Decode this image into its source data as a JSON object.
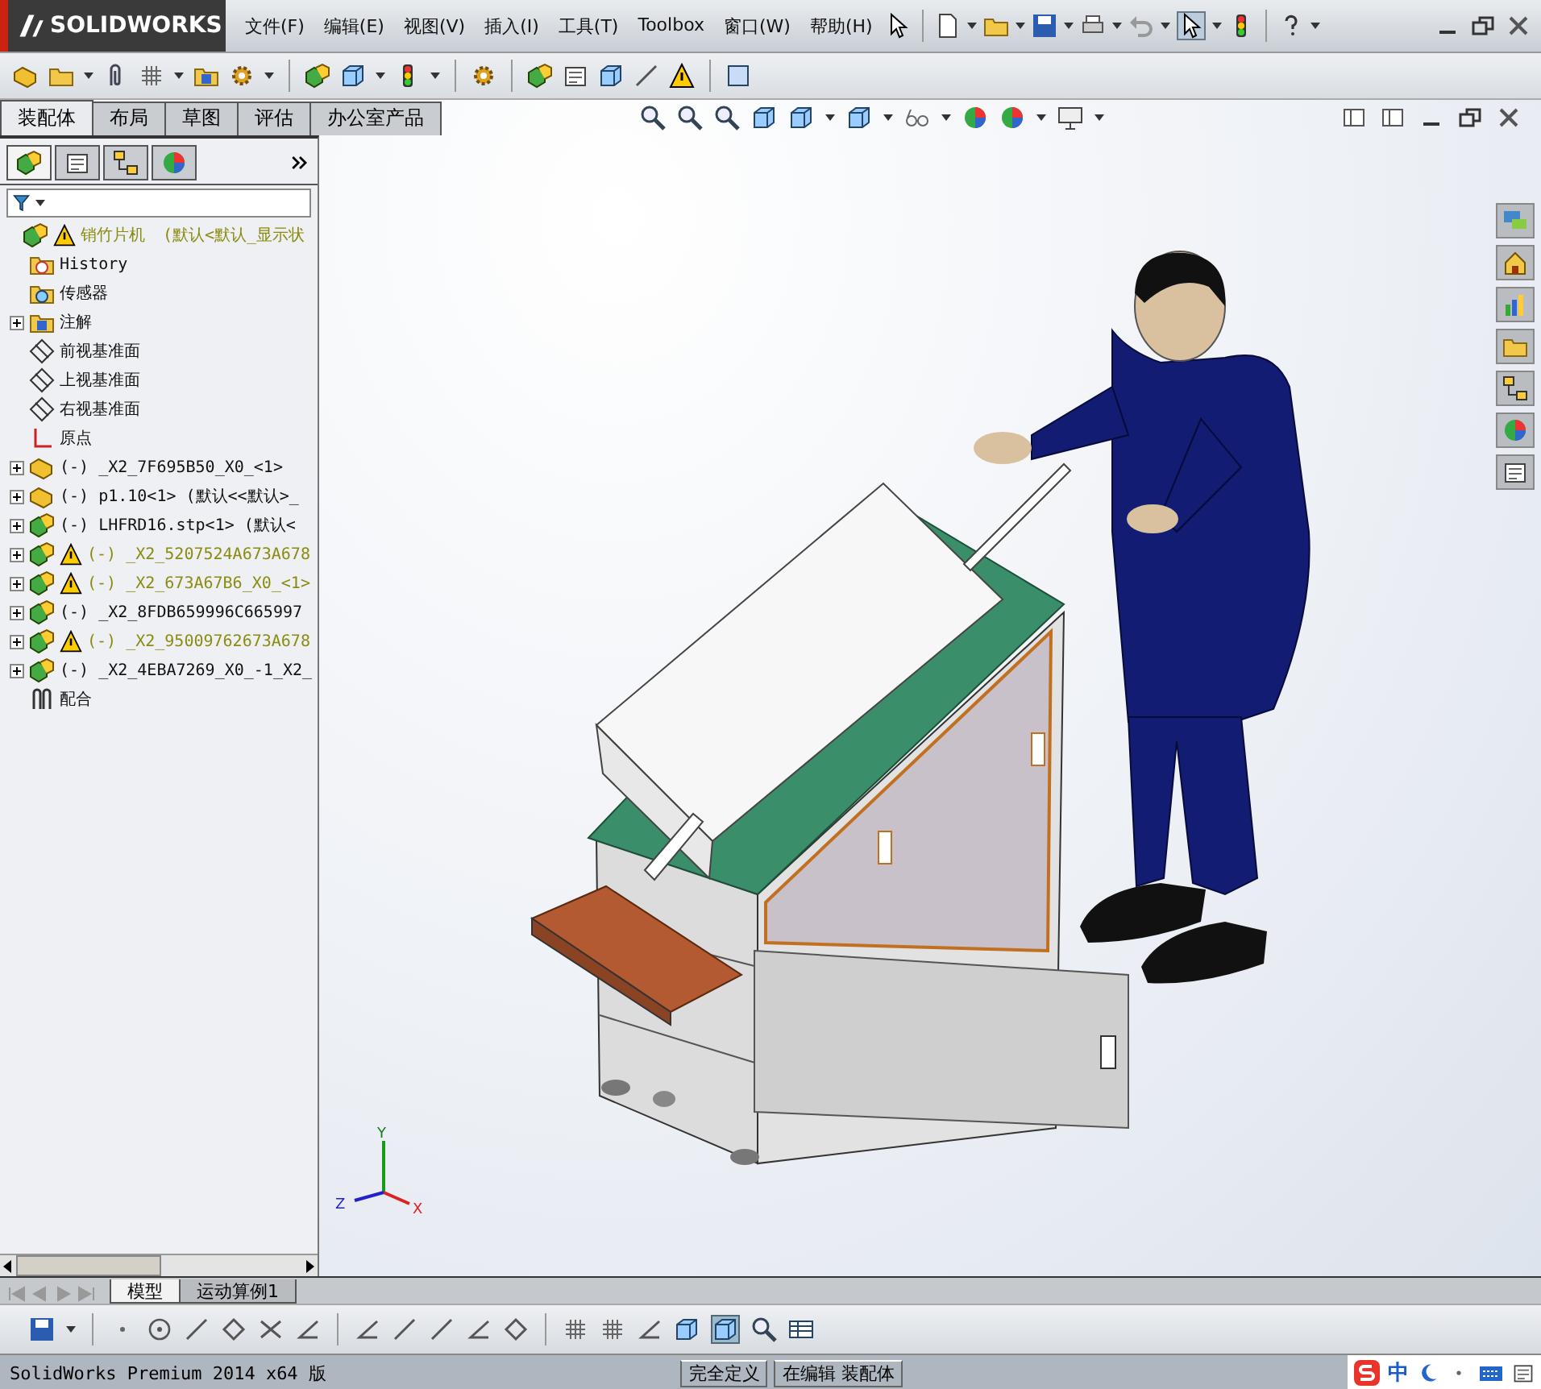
{
  "app": {
    "logo": "SOLIDWORKS",
    "menu": [
      "文件(F)",
      "编辑(E)",
      "视图(V)",
      "插入(I)",
      "工具(T)",
      "Toolbox",
      "窗口(W)",
      "帮助(H)"
    ]
  },
  "command_tabs": [
    {
      "label": "装配体",
      "selected": true
    },
    {
      "label": "布局",
      "selected": false
    },
    {
      "label": "草图",
      "selected": false
    },
    {
      "label": "评估",
      "selected": false
    },
    {
      "label": "办公室产品",
      "selected": false
    }
  ],
  "tree": {
    "label": "销竹片机",
    "configuration": "(默认<默认_显示状",
    "warning": true,
    "children": [
      {
        "label": "History",
        "kind": "history"
      },
      {
        "label": "传感器",
        "kind": "sensor"
      },
      {
        "label": "注解",
        "kind": "annotation",
        "expanded": false
      },
      {
        "label": "前视基准面",
        "kind": "plane"
      },
      {
        "label": "上视基准面",
        "kind": "plane"
      },
      {
        "label": "右视基准面",
        "kind": "plane"
      },
      {
        "label": "原点",
        "kind": "origin"
      },
      {
        "label": "(-) _X2_7F695B50_X0_<1>",
        "kind": "part",
        "expanded": false,
        "warning": false
      },
      {
        "label": "(-) p1.10<1> (默认<<默认>_",
        "kind": "part",
        "expanded": false,
        "warning": false
      },
      {
        "label": "(-) LHFRD16.stp<1> (默认<",
        "kind": "assembly",
        "expanded": false,
        "warning": false
      },
      {
        "label": "(-) _X2_5207524A673A678",
        "kind": "assembly",
        "expanded": false,
        "warning": true
      },
      {
        "label": "(-) _X2_673A67B6_X0_<1>",
        "kind": "assembly",
        "expanded": false,
        "warning": true
      },
      {
        "label": "(-) _X2_8FDB659996C665997",
        "kind": "assembly",
        "expanded": false,
        "warning": false
      },
      {
        "label": "(-) _X2_95009762673A678",
        "kind": "assembly",
        "expanded": false,
        "warning": true
      },
      {
        "label": "(-) _X2_4EBA7269_X0_-1_X2_",
        "kind": "assembly",
        "expanded": false,
        "warning": false
      },
      {
        "label": "配合",
        "kind": "mates"
      }
    ]
  },
  "triad": {
    "x": "X",
    "y": "Y",
    "z": "Z"
  },
  "bottom_tabs": [
    {
      "label": "模型",
      "selected": true
    },
    {
      "label": "运动算例1",
      "selected": false
    }
  ],
  "status_bar": {
    "text": "SolidWorks Premium 2014 x64 版",
    "fields": [
      "完全定义",
      "在编辑 装配体"
    ],
    "ime": "中"
  }
}
